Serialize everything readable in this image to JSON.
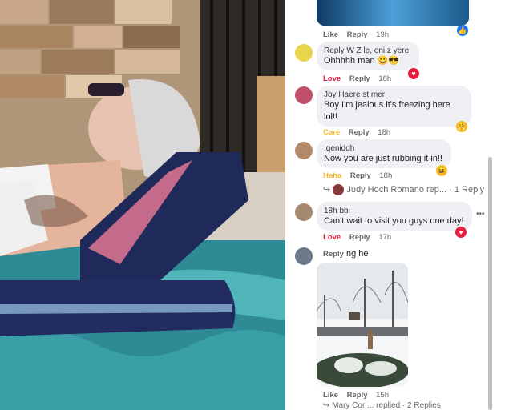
{
  "post_photo": {
    "description_icon": "woman-in-pool-float-photo"
  },
  "top_actions": {
    "like": "Like",
    "reply": "Reply",
    "time": "19h"
  },
  "comments": [
    {
      "name": "Reply W Z le, oni z yere",
      "text": "Ohhhhh man 😀😎",
      "reaction_label": "Love",
      "reply": "Reply",
      "time": "18h"
    },
    {
      "name": "Joy Haere st mer",
      "text": "Boy I'm jealous it's freezing here lol!!",
      "reaction_label": "Care",
      "reply": "Reply",
      "time": "18h"
    },
    {
      "name": ".qeniddh",
      "text": "Now you are just rubbing it in!!",
      "reaction_label": "Haha",
      "reply": "Reply",
      "time": "18h"
    },
    {
      "name": "18h bbi",
      "text": "Can't wait to visit you guys one day!",
      "reaction_label": "Love",
      "reply": "Reply",
      "time": "17h"
    }
  ],
  "reply_thread": {
    "text": "Judy Hoch Romano rep... · 1 Reply"
  },
  "last_comment": {
    "reply": "Reply",
    "name": "ng he",
    "like": "Like",
    "reply2": "Reply",
    "time": "15h",
    "thread_text": "Mary Cor ... replied · 2 Replies"
  },
  "more_icon": "•••"
}
